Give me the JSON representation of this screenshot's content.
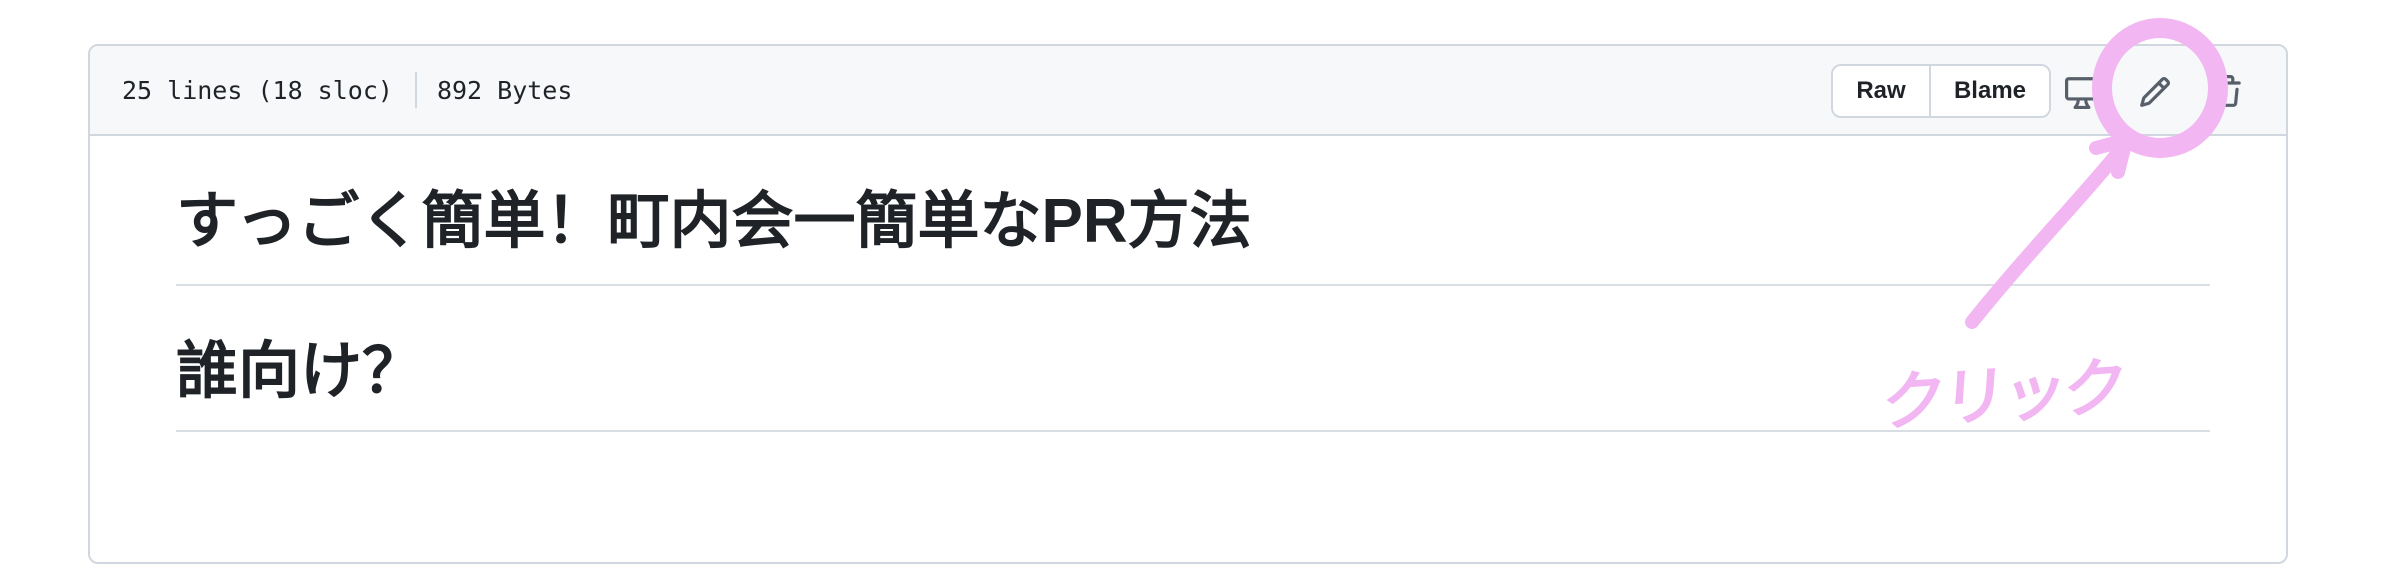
{
  "file_header": {
    "lines": "25 lines (18 sloc)",
    "size": "892 Bytes",
    "raw_label": "Raw",
    "blame_label": "Blame"
  },
  "icons": {
    "display": "desktop-icon",
    "edit": "pencil-icon",
    "delete": "trash-icon"
  },
  "content": {
    "h1": "すっごく簡単！町内会一簡単なPR方法",
    "h2": "誰向け？"
  },
  "annotation": {
    "text": "クリック",
    "color": "#f2b6f2"
  }
}
